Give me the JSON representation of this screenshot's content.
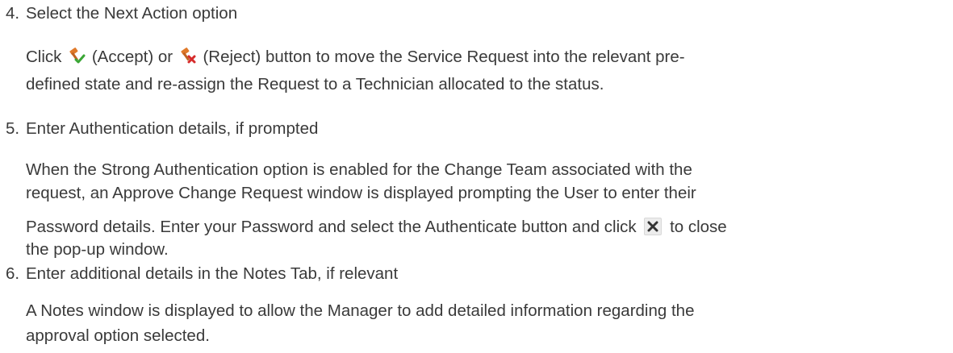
{
  "steps": [
    {
      "number": "4.",
      "title": "Select the Next Action option",
      "body": {
        "part1": "Click",
        "accept_label": "(Accept) or",
        "reject_label": "(Reject) button to move the Service Request into the relevant pre-",
        "line2": "defined state and re-assign the Request to a Technician allocated to the status."
      }
    },
    {
      "number": "5.",
      "title": "Enter Authentication details, if prompted",
      "body": {
        "line1": "When the Strong Authentication option is enabled for the Change Team associated with the",
        "line2": "request, an Approve Change Request window is displayed prompting the User to enter their",
        "line3a": "Password details. Enter your Password and select the Authenticate button and click",
        "line3b": "to close",
        "line4": "the pop-up window."
      }
    },
    {
      "number": "6.",
      "title": "Enter additional details in the Notes Tab, if relevant",
      "body": {
        "line1": "A Notes window is displayed to allow the Manager to add detailed information regarding the",
        "line2": "approval option selected."
      }
    }
  ],
  "icons": {
    "accept": "accept-gavel-icon",
    "reject": "reject-gavel-icon",
    "close": "close-icon"
  },
  "colors": {
    "text": "#3a3a3a",
    "accept_check": "#3aa635",
    "reject_x": "#d62b2b",
    "gavel": "#e07a2a"
  }
}
